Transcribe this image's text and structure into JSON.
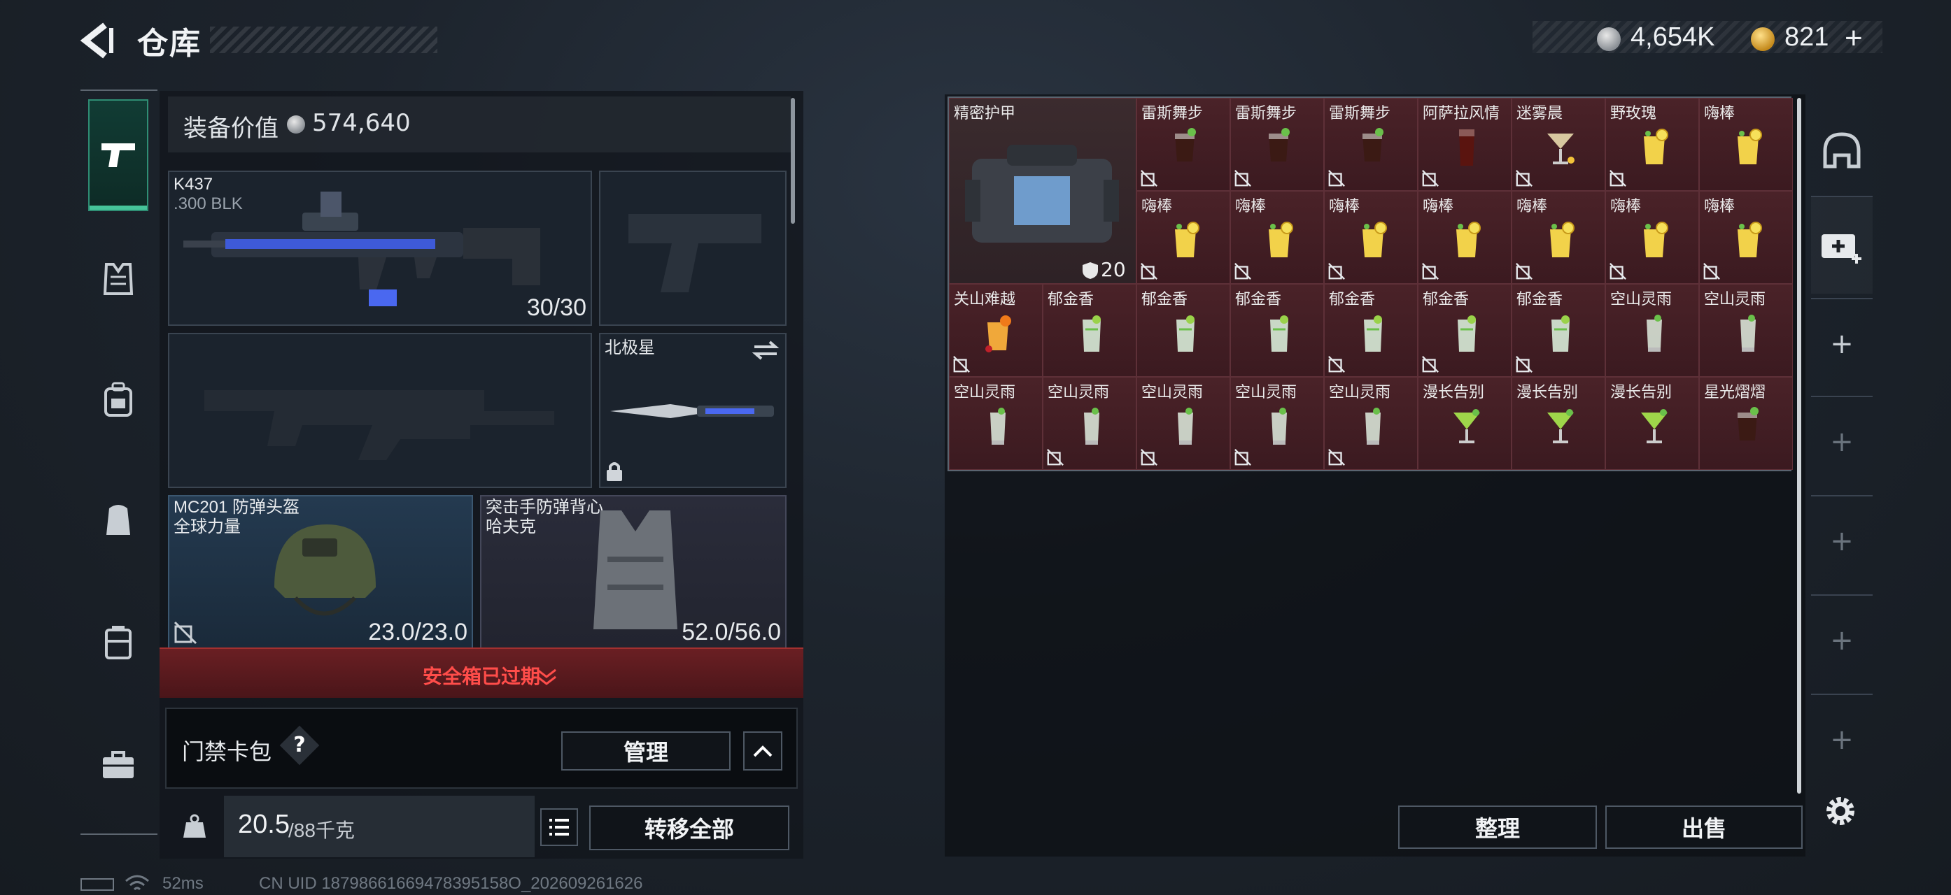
{
  "header": {
    "title": "仓库",
    "currency_primary": "4,654K",
    "currency_secondary": "821",
    "currency_add": "+"
  },
  "rail": {
    "items": [
      "pistol-icon",
      "armor-icon",
      "backpack-icon",
      "rig-icon",
      "container-icon",
      "briefcase-icon"
    ]
  },
  "equip": {
    "value_label": "装备价值",
    "value": "574,640",
    "primary_weapon": {
      "name": "K437",
      "ammo": ".300 BLK",
      "count": "30/30"
    },
    "melee": {
      "name": "北极星"
    },
    "helmet": {
      "name": "MC201 防弹头盔",
      "brand": "全球力量",
      "durability": "23.0/23.0"
    },
    "vest": {
      "name": "突击手防弹背心",
      "brand": "哈夫克",
      "durability": "52.0/56.0"
    },
    "safe_box": "安全箱已过期",
    "card_pack": {
      "label": "门禁卡包",
      "help": "?",
      "manage": "管理"
    },
    "weight": {
      "current": "20.5",
      "max": "/88千克"
    },
    "transfer_all": "转移全部"
  },
  "stash": {
    "armor": {
      "name": "精密护甲",
      "value": "20"
    },
    "items": [
      {
        "name": "雷斯舞步",
        "locked": true,
        "type": "cola"
      },
      {
        "name": "雷斯舞步",
        "locked": true,
        "type": "cola"
      },
      {
        "name": "雷斯舞步",
        "locked": true,
        "type": "cola"
      },
      {
        "name": "阿萨拉风情",
        "locked": true,
        "type": "tall"
      },
      {
        "name": "迷雾晨",
        "locked": true,
        "type": "martini"
      },
      {
        "name": "野玫瑰",
        "locked": true,
        "type": "lemon"
      },
      {
        "name": "嗨棒",
        "locked": false,
        "type": "lemon"
      },
      {
        "name": "嗨棒",
        "locked": true,
        "type": "lemon"
      },
      {
        "name": "嗨棒",
        "locked": true,
        "type": "lemon"
      },
      {
        "name": "嗨棒",
        "locked": true,
        "type": "lemon"
      },
      {
        "name": "嗨棒",
        "locked": true,
        "type": "lemon"
      },
      {
        "name": "嗨棒",
        "locked": true,
        "type": "lemon"
      },
      {
        "name": "嗨棒",
        "locked": true,
        "type": "lemon"
      },
      {
        "name": "嗨棒",
        "locked": true,
        "type": "lemon"
      },
      {
        "name": "关山难越",
        "locked": true,
        "type": "orange"
      },
      {
        "name": "郁金香",
        "locked": false,
        "type": "mojito"
      },
      {
        "name": "郁金香",
        "locked": false,
        "type": "mojito"
      },
      {
        "name": "郁金香",
        "locked": false,
        "type": "mojito"
      },
      {
        "name": "郁金香",
        "locked": true,
        "type": "mojito"
      },
      {
        "name": "郁金香",
        "locked": true,
        "type": "mojito"
      },
      {
        "name": "郁金香",
        "locked": true,
        "type": "mojito"
      },
      {
        "name": "空山灵雨",
        "locked": false,
        "type": "glass"
      },
      {
        "name": "空山灵雨",
        "locked": false,
        "type": "glass"
      },
      {
        "name": "空山灵雨",
        "locked": false,
        "type": "glass"
      },
      {
        "name": "空山灵雨",
        "locked": true,
        "type": "glass"
      },
      {
        "name": "空山灵雨",
        "locked": true,
        "type": "glass"
      },
      {
        "name": "空山灵雨",
        "locked": true,
        "type": "glass"
      },
      {
        "name": "空山灵雨",
        "locked": true,
        "type": "glass"
      },
      {
        "name": "漫长告别",
        "locked": false,
        "type": "cocktail"
      },
      {
        "name": "漫长告别",
        "locked": false,
        "type": "cocktail"
      },
      {
        "name": "漫长告别",
        "locked": false,
        "type": "cocktail"
      },
      {
        "name": "星光熠熠",
        "locked": false,
        "type": "cola"
      }
    ],
    "sort": "整理",
    "sell": "出售"
  },
  "footer": {
    "ping": "52ms",
    "uid": "CN UID 18798661669478395158O_202609261626"
  },
  "colors": {
    "accent_green": "#46c49a",
    "warning_red": "#ff4d4a",
    "cell_bg": "#4a2228"
  }
}
